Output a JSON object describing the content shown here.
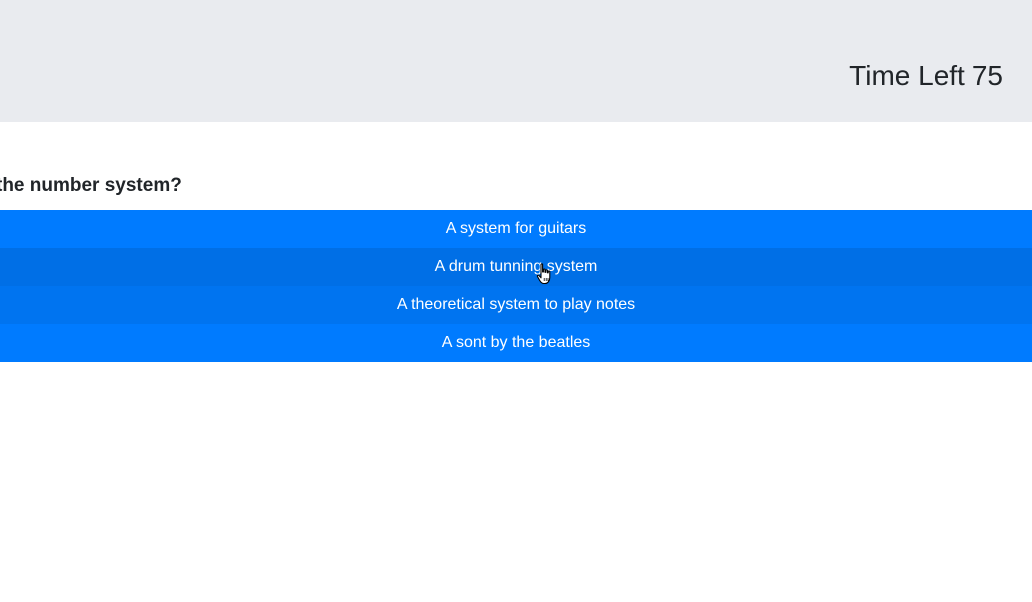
{
  "header": {
    "timer_label": "Time Left",
    "timer_value": "75"
  },
  "question": {
    "text": "the number system?"
  },
  "answers": [
    {
      "label": "A system for guitars"
    },
    {
      "label": "A drum tunning system"
    },
    {
      "label": "A theoretical system to play notes"
    },
    {
      "label": "A sont by the beatles"
    }
  ],
  "colors": {
    "header_background": "#e9ebef",
    "answer_button": "#007bff",
    "answer_button_hover": "#006fe6",
    "text": "#212529"
  },
  "cursor": {
    "icon": "hand-pointer-icon",
    "hovering_answer_index": 1
  }
}
